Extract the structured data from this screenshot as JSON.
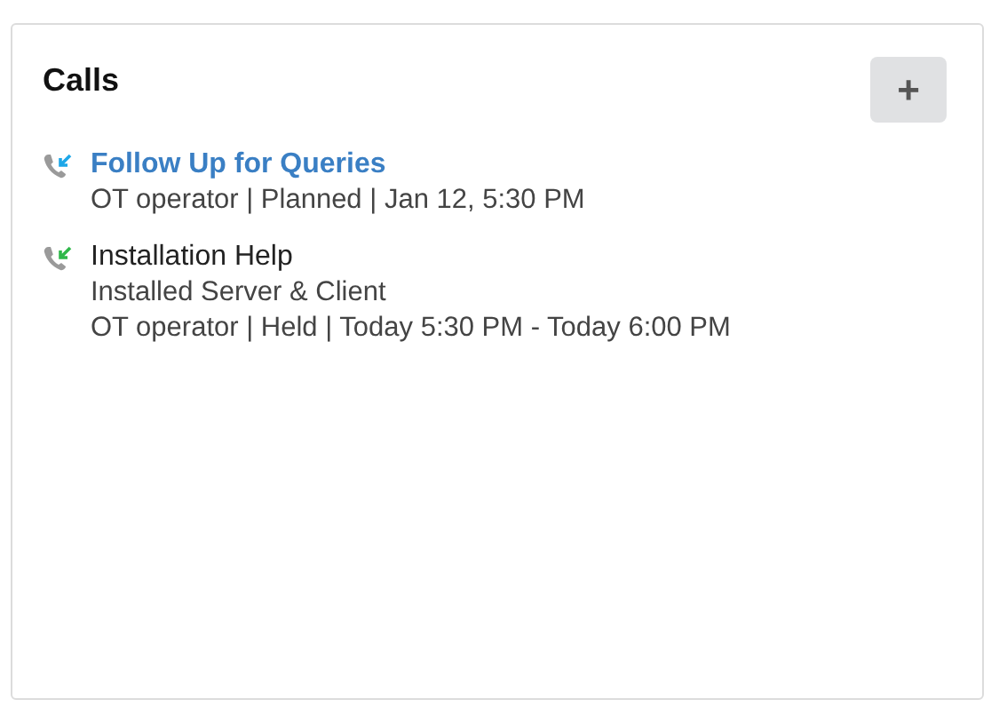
{
  "panel": {
    "title": "Calls",
    "add_button": "+"
  },
  "calls": [
    {
      "kind": "link",
      "color": "#1ea7e8",
      "title": "Follow Up for Queries",
      "lines": [
        "OT operator | Planned | Jan 12, 5:30 PM"
      ]
    },
    {
      "kind": "plain",
      "color": "#2fb84a",
      "title": "Installation Help",
      "lines": [
        "Installed Server & Client",
        "OT operator | Held | Today 5:30 PM - Today 6:00 PM"
      ]
    }
  ]
}
